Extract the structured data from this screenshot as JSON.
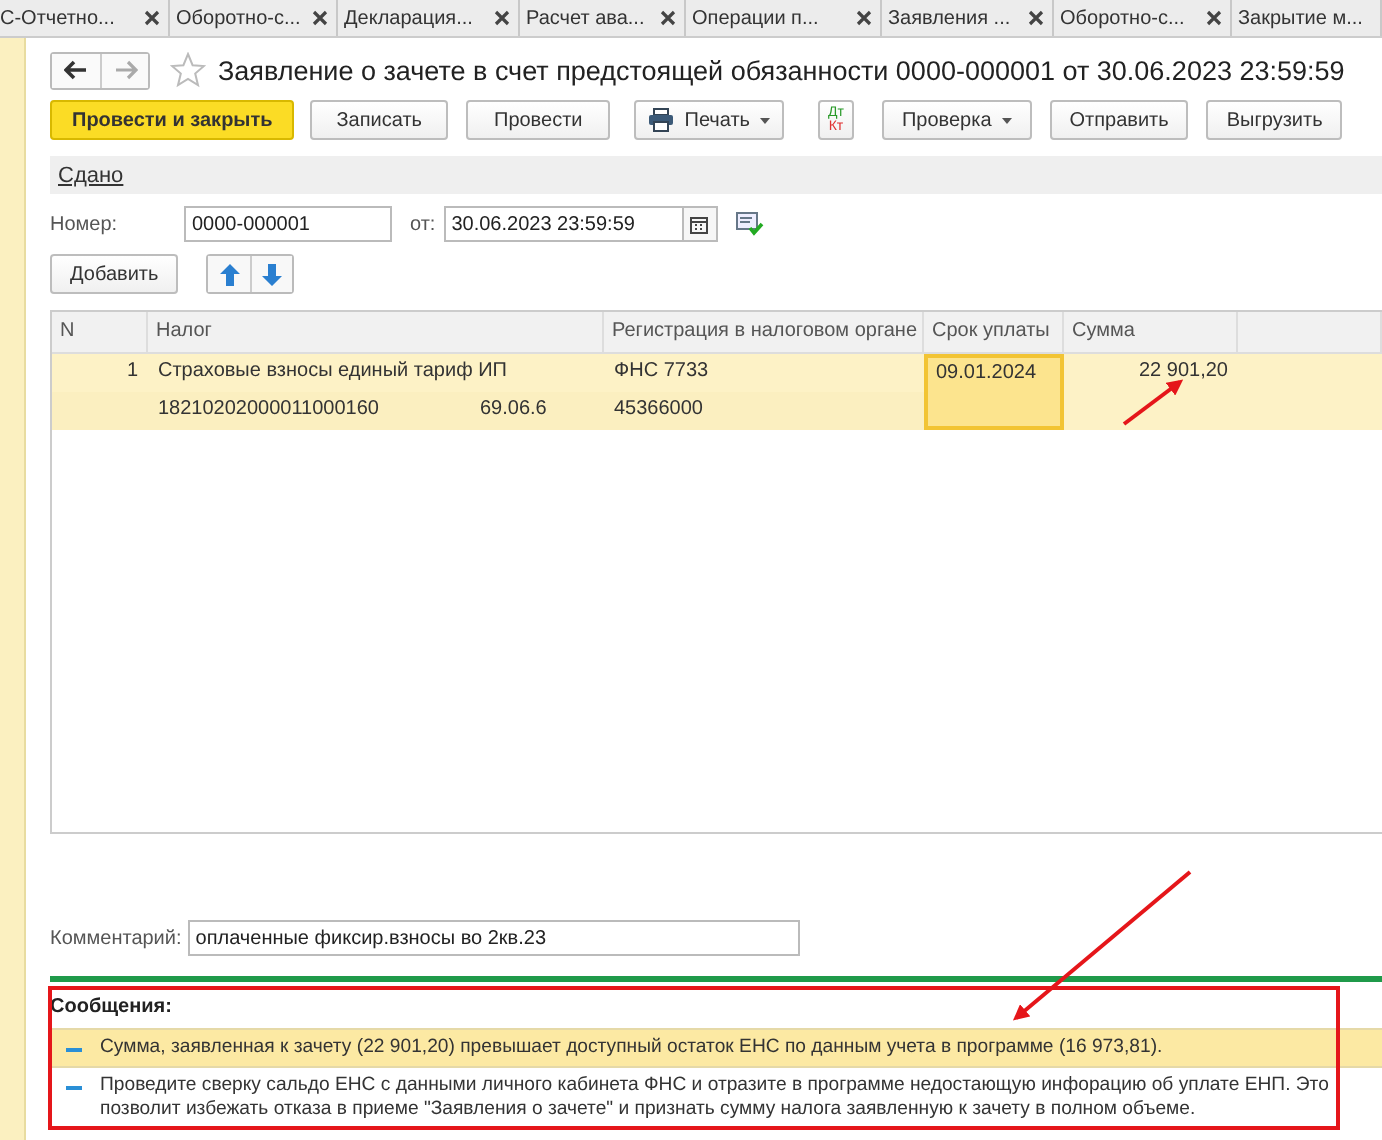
{
  "tabs": [
    {
      "label": "С-Отчетно...",
      "selected": false,
      "closable": true
    },
    {
      "label": "Оборотно-с...",
      "selected": false,
      "closable": true
    },
    {
      "label": "Декларация...",
      "selected": false,
      "closable": true
    },
    {
      "label": "Расчет  ава...",
      "selected": false,
      "closable": true
    },
    {
      "label": "Операции п...",
      "selected": false,
      "closable": true
    },
    {
      "label": "Заявления ...",
      "selected": false,
      "closable": true
    },
    {
      "label": "Оборотно-с...",
      "selected": false,
      "closable": true
    },
    {
      "label": "Закрытие м...",
      "selected": false,
      "closable": false
    }
  ],
  "title": "Заявление о зачете в счет предстоящей обязанности 0000-000001 от 30.06.2023 23:59:59",
  "toolbar": [
    {
      "kind": "primary",
      "label": "Провести и закрыть"
    },
    {
      "kind": "plain",
      "label": "Записать"
    },
    {
      "kind": "plain",
      "label": "Провести"
    },
    {
      "kind": "print",
      "label": "Печать"
    },
    {
      "kind": "dtkt",
      "top": "Дт",
      "bottom": "Кт"
    },
    {
      "kind": "menu",
      "label": "Проверка"
    },
    {
      "kind": "plain",
      "label": "Отправить"
    },
    {
      "kind": "plain",
      "label": "Выгрузить"
    }
  ],
  "status_link": "Сдано",
  "number": {
    "label": "Номер:",
    "value": "0000-000001"
  },
  "date": {
    "label": "от:",
    "value": "30.06.2023 23:59:59"
  },
  "add_button": "Добавить",
  "table": {
    "columns": [
      "N",
      "Налог",
      "Регистрация в налоговом органе",
      "Срок уплаты",
      "Сумма"
    ],
    "rows": [
      {
        "selected": true,
        "due_focused": true,
        "n": "1",
        "tax": "Страховые взносы единый тариф ИП",
        "kbk": "18210202000011000160",
        "account": "69.06.6",
        "registration": "ФНС 7733",
        "oktmo": "45366000",
        "due": "09.01.2024",
        "sum": "22 901,20"
      }
    ]
  },
  "comment": {
    "label": "Комментарий:",
    "value": "оплаченные фиксир.взносы во 2кв.23"
  },
  "messages_title": "Сообщения:",
  "messages": [
    {
      "selected": true,
      "text": "Сумма, заявленная к зачету (22 901,20) превышает доступный остаток ЕНС по данным учета в программе (16 973,81)."
    },
    {
      "selected": false,
      "text": "Проведите сверку сальдо ЕНС с данными личного кабинета ФНС и отразите в программе недостающую инфорацию об уплате ЕНП. Это позволит избежать отказа в приеме \"Заявления о зачете\" и признать сумму налога заявленную к зачету в полном объеме."
    }
  ]
}
